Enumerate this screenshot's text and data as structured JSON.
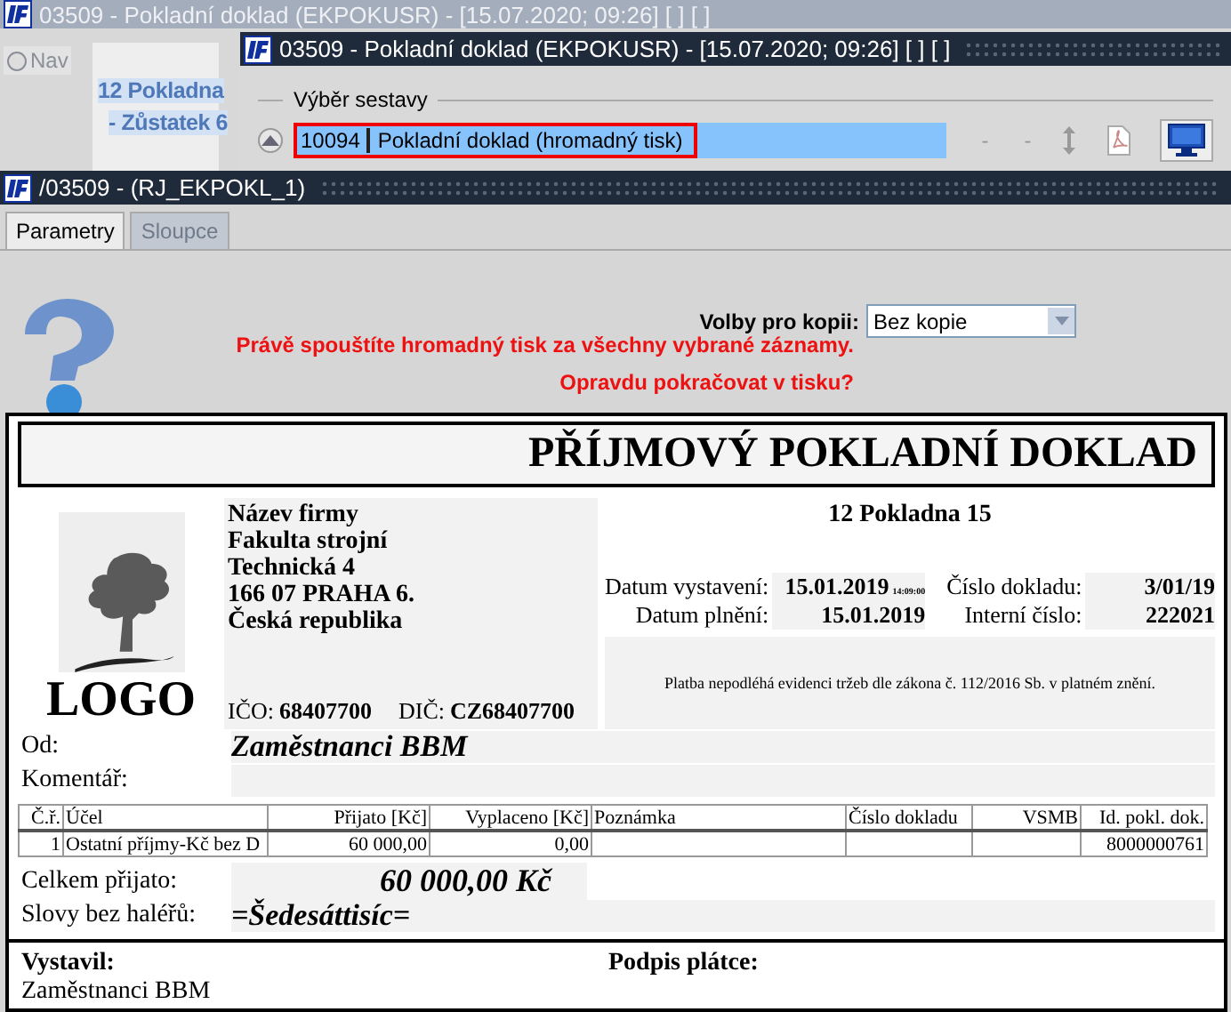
{
  "back_window": {
    "title": "03509 - Pokladní doklad (EKPOKUSR) - [15.07.2020; 09:26]  [ ]  [ ]",
    "nav": {
      "label": "Nav",
      "selected": false
    },
    "tree_items": [
      "12 Pokladna",
      "- Zůstatek 6"
    ]
  },
  "report_window": {
    "title": "03509 - Pokladní doklad (EKPOKUSR) - [15.07.2020; 09:26]  [ ]  [ ]",
    "group_label": "Výběr sestavy",
    "reports": [
      {
        "code": "10094",
        "name": "Pokladní doklad (hromadný tisk)",
        "selected": true
      }
    ],
    "toolbar_marks": [
      "-",
      "-"
    ]
  },
  "print_window": {
    "title": "/03509 - (RJ_EKPOKL_1)",
    "tabs": [
      {
        "label": "Parametry",
        "selected": true,
        "disabled": false
      },
      {
        "label": "Sloupce",
        "selected": false,
        "disabled": true
      }
    ],
    "copy_options": {
      "label": "Volby pro kopii:",
      "value": "Bez kopie"
    },
    "warnings": [
      "Právě spouštíte hromadný tisk za všechny vybrané záznamy.",
      "Opravdu pokračovat v tisku?"
    ]
  },
  "document": {
    "title": "PŘÍJMOVÝ POKLADNÍ DOKLAD",
    "logo_text": "LOGO",
    "company_lines": [
      "Název firmy",
      "Fakulta strojní",
      "Technická 4",
      "166 07 PRAHA 6.",
      "Česká republika"
    ],
    "ids": [
      {
        "label": "IČO:",
        "value": "68407700"
      },
      {
        "label": "DIČ:",
        "value": "CZ68407700"
      }
    ],
    "cash_desk": "12 Pokladna 15",
    "dates": [
      {
        "label": "Datum vystavení:",
        "value": "15.01.2019",
        "time": "14:09:00"
      },
      {
        "label": "Datum plnění:",
        "value": "15.01.2019"
      }
    ],
    "numbers": [
      {
        "label": "Číslo dokladu:",
        "value": "3/01/19"
      },
      {
        "label": "Interní číslo:",
        "value": "222021"
      }
    ],
    "note": "Platba nepodléhá evidenci tržeb dle zákona č. 112/2016 Sb. v platném znění.",
    "from": {
      "label": "Od:",
      "value": "Zaměstnanci BBM"
    },
    "comment": {
      "label": "Komentář:"
    },
    "table": {
      "columns": [
        {
          "label": "Č.ř.",
          "numeric": true
        },
        {
          "label": "Účel",
          "numeric": false
        },
        {
          "label": "Přijato [Kč]",
          "numeric": true
        },
        {
          "label": "Vyplaceno [Kč]",
          "numeric": true
        },
        {
          "label": "Poznámka",
          "numeric": false
        },
        {
          "label": "Číslo dokladu",
          "numeric": false
        },
        {
          "label": "VSMB",
          "numeric": true
        },
        {
          "label": "Id. pokl. dok.",
          "numeric": true
        }
      ],
      "rows": [
        [
          "1",
          "Ostatní příjmy-Kč bez D",
          "60 000,00",
          "0,00",
          null,
          null,
          null,
          "8000000761"
        ]
      ]
    },
    "total": {
      "label": "Celkem přijato:",
      "value": "60 000,00 Kč"
    },
    "in_words": {
      "label": "Slovy bez haléřů:",
      "value": "=Šedesáttisíc="
    },
    "issued_by": {
      "label": "Vystavil:",
      "value": "Zaměstnanci BBM"
    },
    "signature": {
      "label": "Podpis plátce:"
    }
  }
}
